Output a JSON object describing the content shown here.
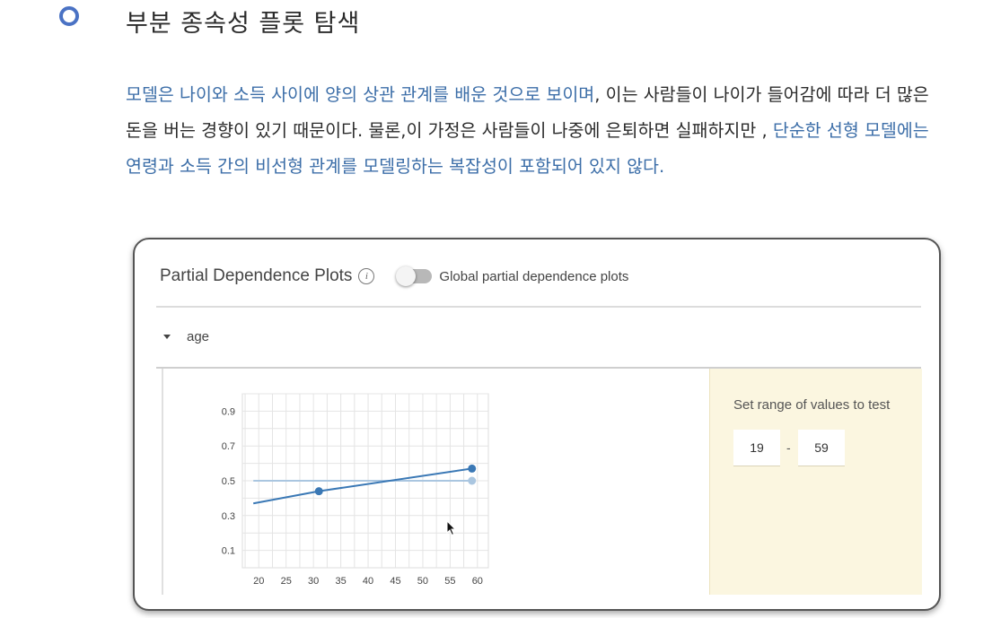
{
  "section": {
    "heading": "부분 종속성 플롯 탐색",
    "paragraph": [
      {
        "text": "모델은 나이와 소득 사이에 양의 상관 관계를 배운 것으로 보이며",
        "highlight": true
      },
      {
        "text": ", 이는 사람들이 나이가 들어감에 따라 더 많은 돈을 버는 경향이 있기 때문이다. 물론,이 가정은 사람들이 나중에 은퇴하면 실패하지만 , ",
        "highlight": false
      },
      {
        "text": "단순한 선형 모델에는 연령과 소득 간의 비선형 관계를 모델링하는 복잡성이 포함되어 있지 않다.",
        "highlight": true
      }
    ],
    "highlight_color": "#3c6ea8",
    "bullet_color": "#4a72c4"
  },
  "panel": {
    "title": "Partial Dependence Plots",
    "info_icon": "info-icon",
    "toggle_label": "Global partial dependence plots",
    "toggle_on": false,
    "feature_name": "age",
    "range_title": "Set range of values to test",
    "range_min": "19",
    "range_sep": "-",
    "range_max": "59"
  },
  "chart_data": {
    "type": "line",
    "x_ticks": [
      20,
      25,
      30,
      35,
      40,
      45,
      50,
      55,
      60
    ],
    "y_ticks": [
      0.1,
      0.3,
      0.5,
      0.7,
      0.9
    ],
    "xlim": [
      17,
      62
    ],
    "ylim": [
      0,
      1.0
    ],
    "grid": true,
    "series": [
      {
        "color": "#3a78b5",
        "x": [
          19,
          31,
          59
        ],
        "y": [
          0.37,
          0.44,
          0.57
        ],
        "markers": [
          31,
          59
        ]
      },
      {
        "color": "#aac6e0",
        "x": [
          19,
          59
        ],
        "y": [
          0.5,
          0.5
        ],
        "markers": [
          59
        ]
      }
    ]
  }
}
